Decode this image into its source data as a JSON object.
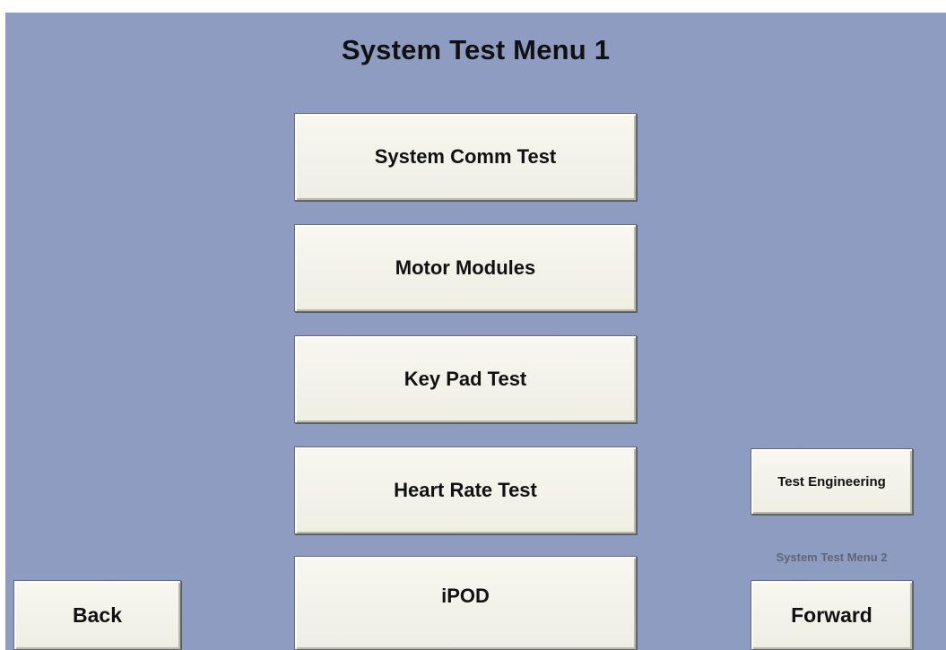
{
  "theme": {
    "panel_bg": "#8e9cc1"
  },
  "header": {
    "title": "System Test Menu 1"
  },
  "menu": {
    "items": [
      {
        "label": "System Comm Test"
      },
      {
        "label": "Motor Modules"
      },
      {
        "label": "Key Pad Test"
      },
      {
        "label": "Heart Rate Test"
      },
      {
        "label": "iPOD"
      }
    ]
  },
  "nav": {
    "back_label": "Back",
    "test_engineering_label": "Test Engineering",
    "next_menu_label": "System Test Menu 2",
    "forward_label": "Forward"
  }
}
